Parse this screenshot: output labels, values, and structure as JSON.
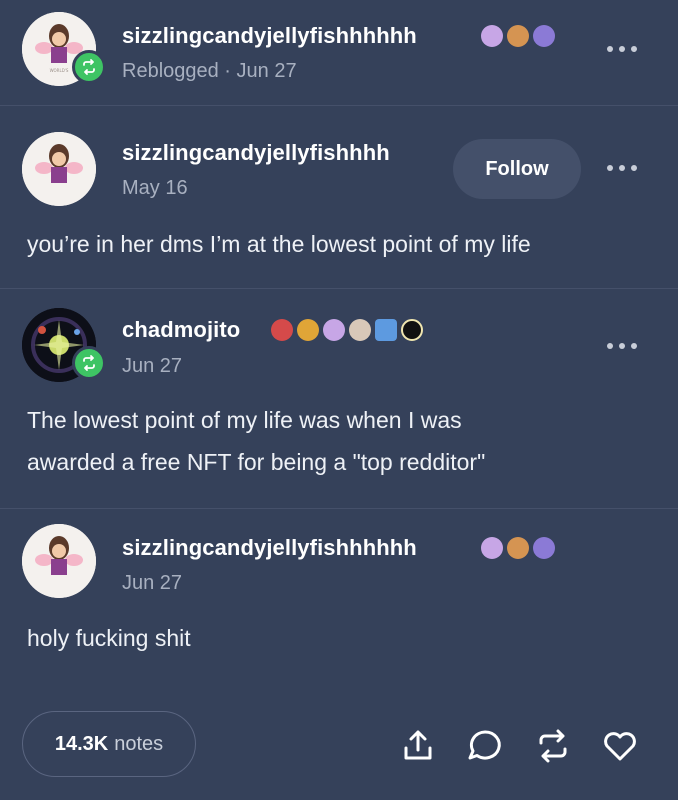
{
  "posts": [
    {
      "username": "sizzlingcandyjellyfishhhhhh",
      "meta": "Reblogged · Jun 27"
    },
    {
      "username": "sizzlingcandyjellyfishhhh",
      "meta": "May 16",
      "follow_label": "Follow",
      "text": "you’re in her dms I’m at the lowest point of my life"
    },
    {
      "username": "chadmojito",
      "meta": "Jun 27",
      "text_lines": [
        "The lowest point of my life was when I was",
        "awarded a free NFT for being a \"top redditor\""
      ]
    },
    {
      "username": "sizzlingcandyjellyfishhhhhh",
      "meta": "Jun 27",
      "text": "holy fucking shit"
    }
  ],
  "footer": {
    "notes_count": "14.3K",
    "notes_label": "notes",
    "actions": [
      "share-icon",
      "reply-icon",
      "reblog-icon",
      "like-icon"
    ]
  },
  "colors": {
    "background": "#35415a",
    "reblog_green": "#3ec464",
    "meta_gray": "#a8b0c0"
  }
}
